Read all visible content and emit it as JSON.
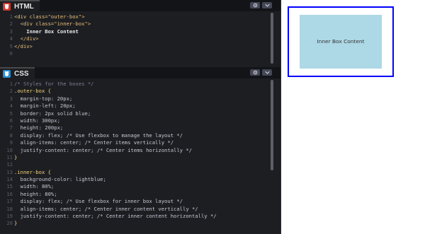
{
  "html_panel": {
    "title": "HTML",
    "icon": "html-icon",
    "icon_color": "#d33a2c",
    "lines": [
      {
        "num": "1",
        "text": "<div class=\"outer-box\">"
      },
      {
        "num": "2",
        "text": "  <div class=\"inner-box\">"
      },
      {
        "num": "3",
        "text": "    Inner Box Content"
      },
      {
        "num": "4",
        "text": "  </div>"
      },
      {
        "num": "5",
        "text": "</div>"
      },
      {
        "num": "6",
        "text": ""
      }
    ]
  },
  "css_panel": {
    "title": "CSS",
    "icon": "css-icon",
    "icon_color": "#2a8fd6",
    "lines": [
      {
        "num": "1",
        "text": "/* Styles for the boxes */"
      },
      {
        "num": "2",
        "text": ".outer-box {"
      },
      {
        "num": "3",
        "text": "  margin-top: 20px;"
      },
      {
        "num": "4",
        "text": "  margin-left: 20px;"
      },
      {
        "num": "5",
        "text": "  border: 2px solid blue;"
      },
      {
        "num": "6",
        "text": "  width: 300px;"
      },
      {
        "num": "7",
        "text": "  height: 200px;"
      },
      {
        "num": "8",
        "text": "  display: flex; /* Use flexbox to manage the layout */"
      },
      {
        "num": "9",
        "text": "  align-items: center; /* Center items vertically */"
      },
      {
        "num": "10",
        "text": "  justify-content: center; /* Center items horizontally */"
      },
      {
        "num": "11",
        "text": "}"
      },
      {
        "num": "12",
        "text": ""
      },
      {
        "num": "13",
        "text": ".inner-box {"
      },
      {
        "num": "14",
        "text": "  background-color: lightblue;"
      },
      {
        "num": "15",
        "text": "  width: 80%;"
      },
      {
        "num": "16",
        "text": "  height: 80%;"
      },
      {
        "num": "17",
        "text": "  display: flex; /* Use flexbox for inner box layout */"
      },
      {
        "num": "18",
        "text": "  align-items: center; /* Center inner content vertically */"
      },
      {
        "num": "19",
        "text": "  justify-content: center; /* Center inner content horizontally */"
      },
      {
        "num": "20",
        "text": "}"
      }
    ]
  },
  "preview": {
    "inner_text": "Inner Box Content",
    "outer_border_color": "blue",
    "inner_background": "lightblue"
  },
  "colors": {
    "editor_background": "#1d1e22",
    "header_background": "#131417"
  },
  "controls": {
    "settings_icon": "gear-icon",
    "collapse_icon": "chevron-down-icon"
  }
}
